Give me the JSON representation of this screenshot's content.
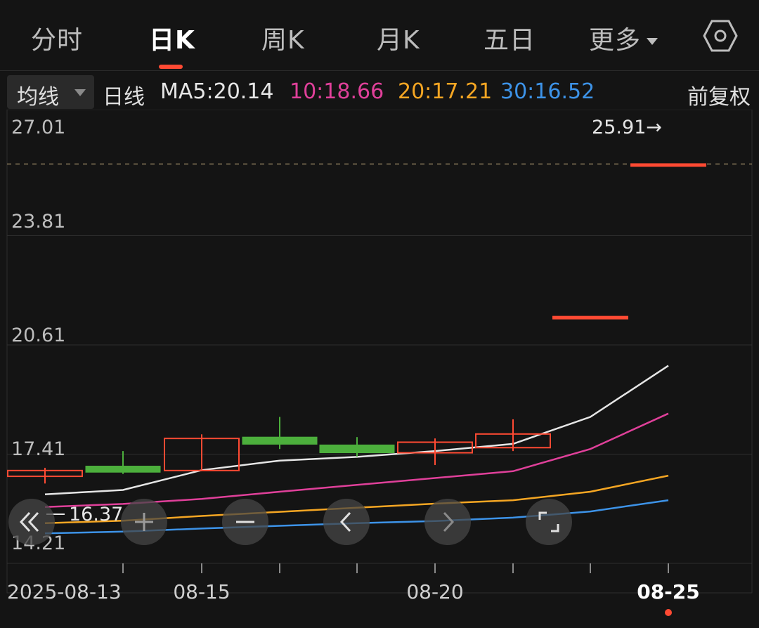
{
  "tabs": [
    {
      "label": "分时",
      "active": false
    },
    {
      "label": "日K",
      "active": true
    },
    {
      "label": "周K",
      "active": false
    },
    {
      "label": "月K",
      "active": false
    },
    {
      "label": "五日",
      "active": false
    },
    {
      "label": "更多",
      "active": false
    }
  ],
  "settings_icon": "hexagon-gear-icon",
  "ma_bar": {
    "selector": "均线",
    "period": "日线",
    "ma5": "MA5:20.14",
    "ma10": "10:18.66",
    "ma20": "20:17.21",
    "ma30": "30:16.52",
    "adjust": "前复权"
  },
  "colors": {
    "up": "#ff4a33",
    "down": "#4caf3c",
    "ma5": "#e6e6e6",
    "ma10": "#e0409a",
    "ma20": "#f5a623",
    "ma30": "#3d93e8",
    "background": "#141414"
  },
  "chart_data": {
    "type": "candlestick",
    "y_ticks": [
      "27.01",
      "23.81",
      "20.61",
      "17.41",
      "14.21"
    ],
    "ylim": [
      14.21,
      27.01
    ],
    "x_tick_labels": [
      "2025-08-13",
      "08-15",
      "08-20",
      "08-25"
    ],
    "x_tick_label_index": [
      0,
      2,
      5,
      8
    ],
    "high_marker": "25.91→",
    "low_marker": "16.37",
    "candles": [
      {
        "open": 16.76,
        "close": 16.93,
        "high": 17.01,
        "low": 16.55
      },
      {
        "open": 17.06,
        "close": 16.88,
        "high": 17.5,
        "low": 16.83
      },
      {
        "open": 16.93,
        "close": 17.87,
        "high": 17.99,
        "low": 16.93
      },
      {
        "open": 17.91,
        "close": 17.7,
        "high": 18.5,
        "low": 17.56
      },
      {
        "open": 17.68,
        "close": 17.45,
        "high": 17.91,
        "low": 17.34
      },
      {
        "open": 17.45,
        "close": 17.76,
        "high": 17.87,
        "low": 17.09
      },
      {
        "open": 17.6,
        "close": 18.0,
        "high": 18.43,
        "low": 17.5
      },
      {
        "open": 21.44,
        "close": 21.44,
        "high": 21.44,
        "low": 21.44
      },
      {
        "open": 25.91,
        "close": 25.91,
        "high": 25.91,
        "low": 25.91
      }
    ],
    "series": [
      {
        "name": "MA5",
        "values": [
          16.23,
          16.36,
          16.94,
          17.22,
          17.33,
          17.5,
          17.71,
          18.5,
          20.0
        ]
      },
      {
        "name": "MA10",
        "values": [
          15.86,
          15.95,
          16.1,
          16.31,
          16.51,
          16.71,
          16.91,
          17.56,
          18.6
        ]
      },
      {
        "name": "MA20",
        "values": [
          15.39,
          15.46,
          15.6,
          15.72,
          15.84,
          15.96,
          16.06,
          16.31,
          16.78
        ]
      },
      {
        "name": "MA30",
        "values": [
          15.09,
          15.14,
          15.23,
          15.31,
          15.39,
          15.45,
          15.55,
          15.73,
          16.06
        ]
      }
    ]
  },
  "controls": [
    {
      "name": "scroll-left-fast-button",
      "icon": "double-chevron-left-icon"
    },
    {
      "name": "zoom-in-button",
      "icon": "plus-icon"
    },
    {
      "name": "zoom-out-button",
      "icon": "minus-icon"
    },
    {
      "name": "scroll-left-button",
      "icon": "chevron-left-icon"
    },
    {
      "name": "scroll-right-button",
      "icon": "chevron-right-icon"
    },
    {
      "name": "fullscreen-button",
      "icon": "fullscreen-icon"
    }
  ]
}
